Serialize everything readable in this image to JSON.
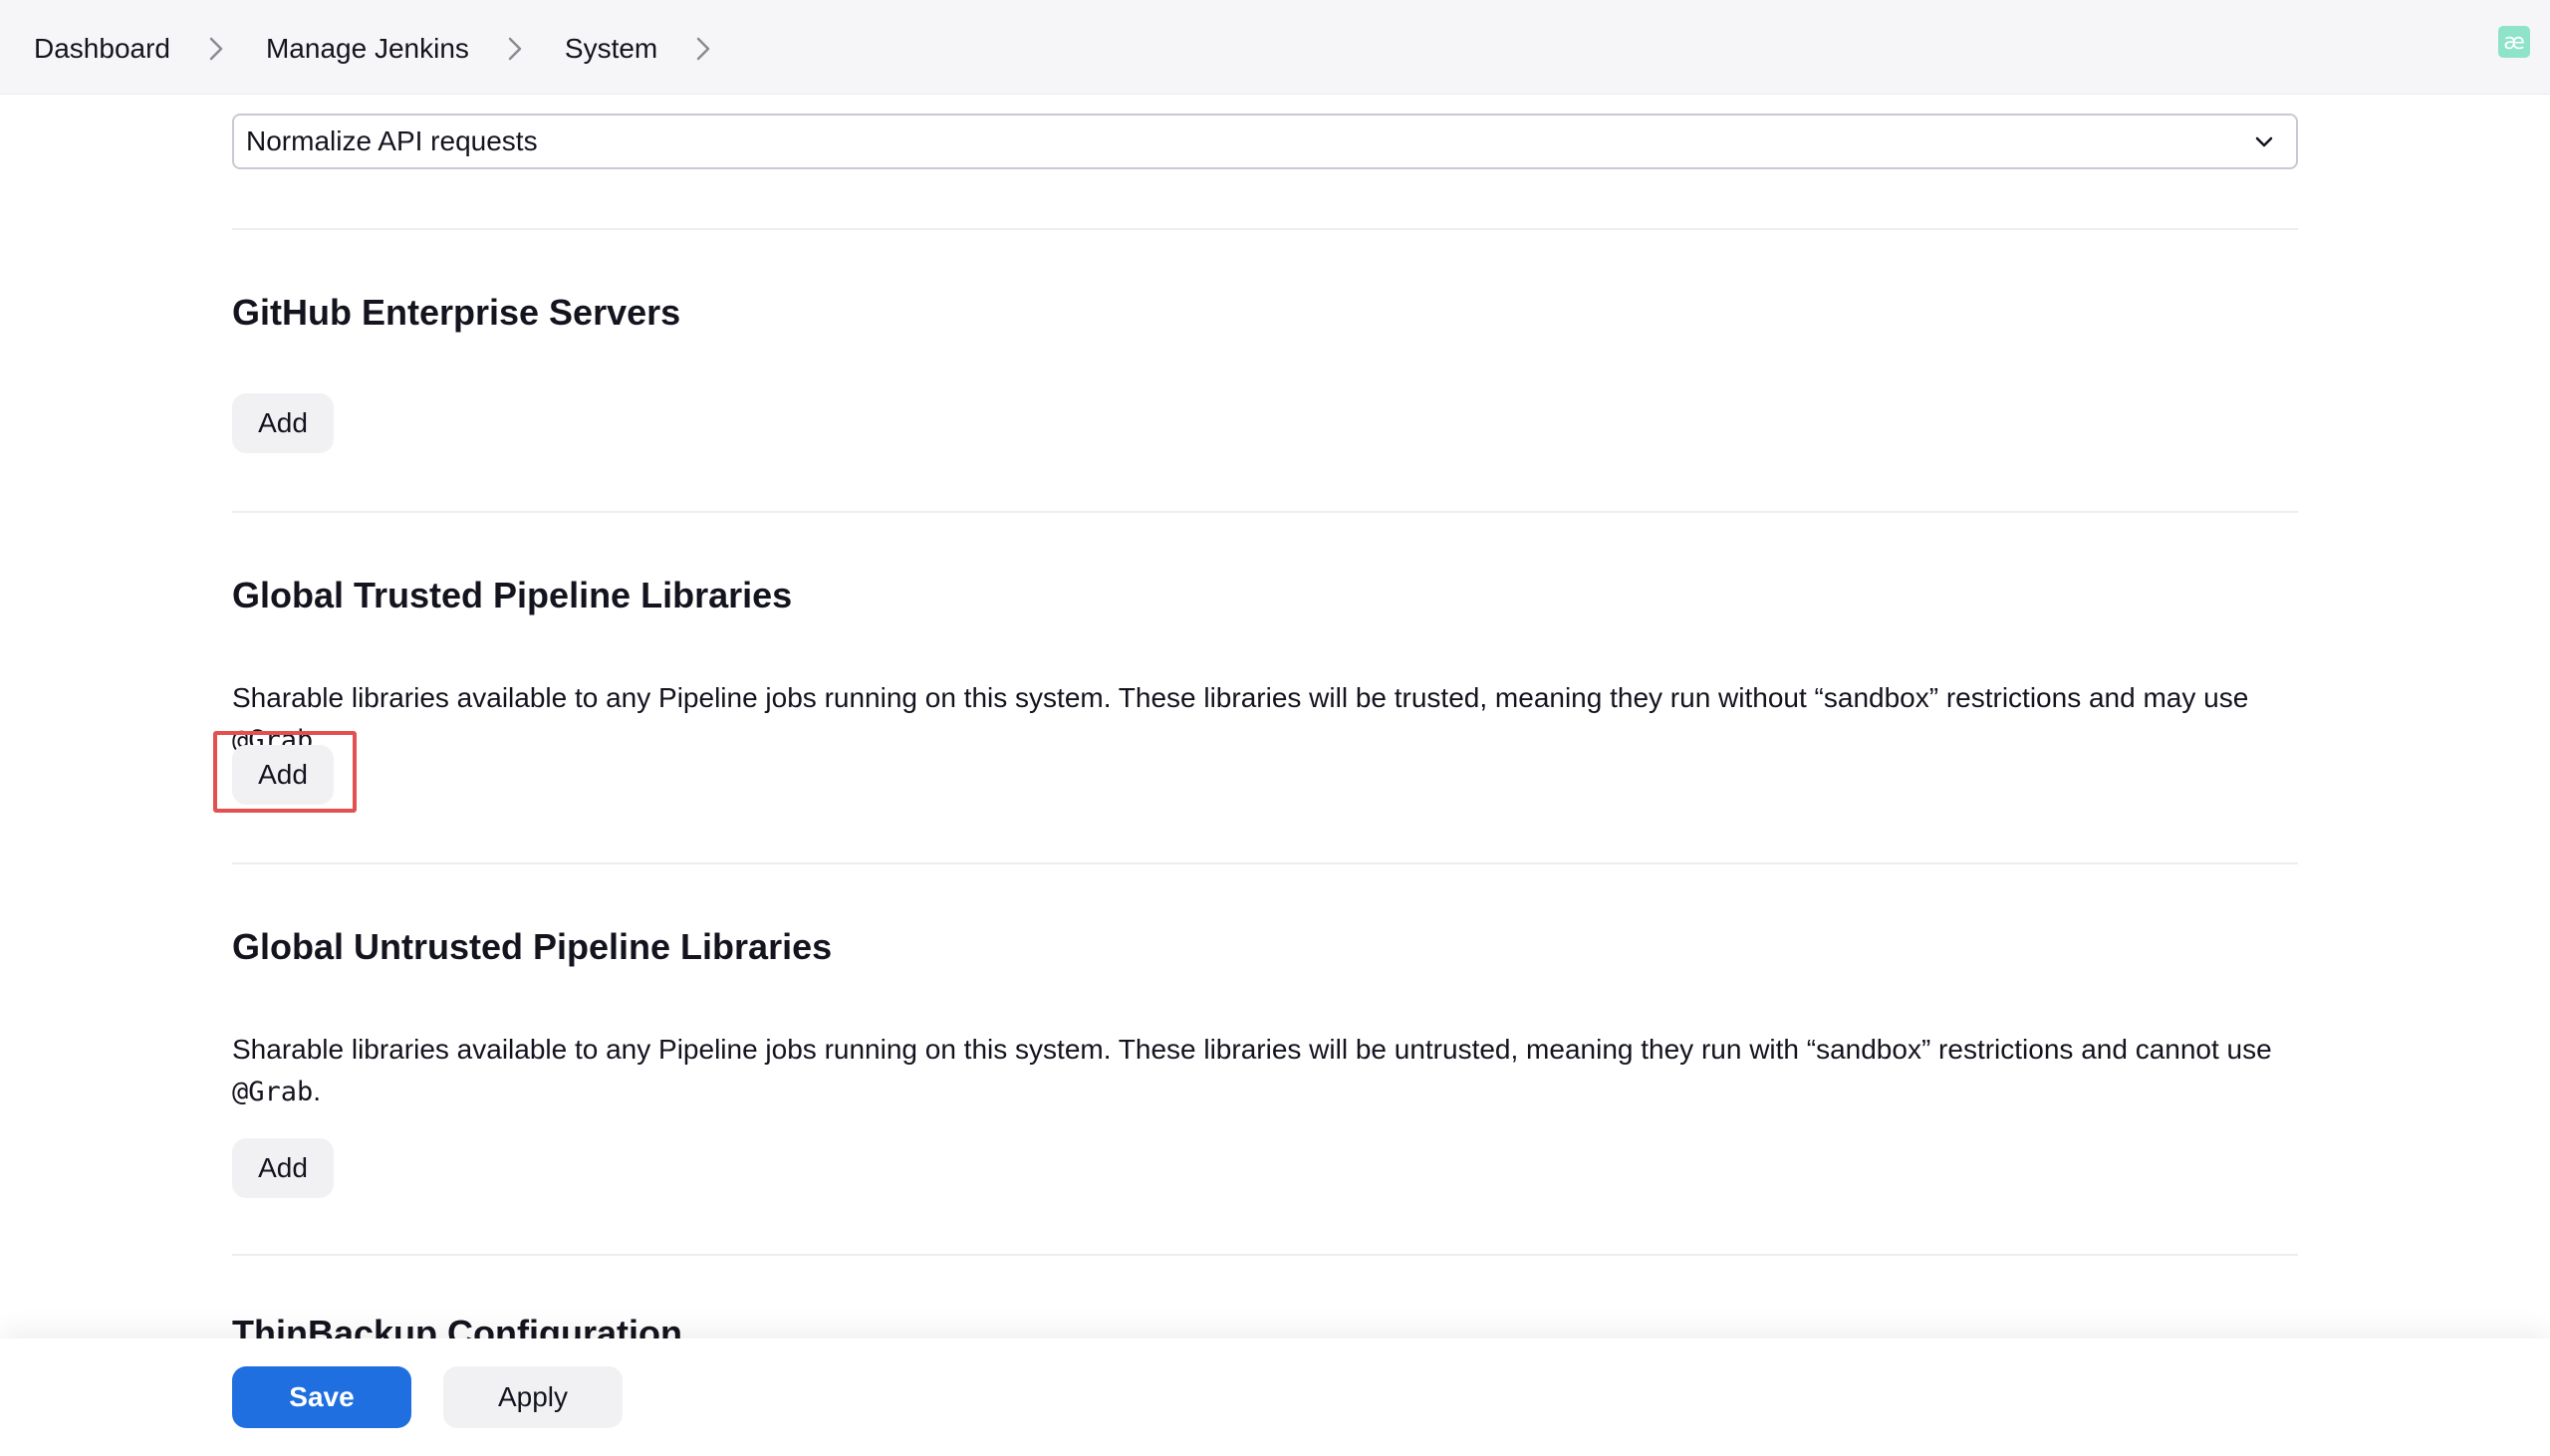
{
  "breadcrumb": {
    "items": [
      "Dashboard",
      "Manage Jenkins",
      "System"
    ]
  },
  "top_select": {
    "value": "Normalize API requests"
  },
  "sections": [
    {
      "title": "GitHub Enterprise Servers",
      "add_label": "Add"
    },
    {
      "title": "Global Trusted Pipeline Libraries",
      "description_text": "Sharable libraries available to any Pipeline jobs running on this system. These libraries will be trusted, meaning they run without “sandbox” restrictions and may use ",
      "description_code": "@Grab",
      "description_end": ".",
      "add_label": "Add",
      "highlighted": true
    },
    {
      "title": "Global Untrusted Pipeline Libraries",
      "description_text": "Sharable libraries available to any Pipeline jobs running on this system. These libraries will be untrusted, meaning they run with “sandbox” restrictions and cannot use ",
      "description_code": "@Grab",
      "description_end": ".",
      "add_label": "Add"
    }
  ],
  "partial_section_title": "ThinBackup Configuration",
  "footer": {
    "save_label": "Save",
    "apply_label": "Apply"
  },
  "colors": {
    "primary": "#1f6fe0",
    "highlight": "#e25050",
    "button_bg": "#f1f1f4"
  }
}
